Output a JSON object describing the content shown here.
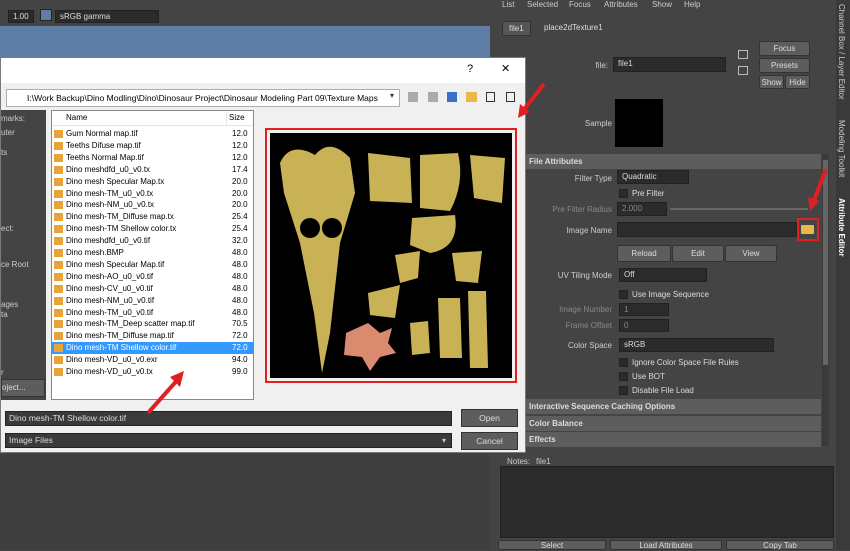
{
  "viewport": {
    "value_field": "1.00",
    "colorspace": "sRGB gamma"
  },
  "left_panel": {
    "items": [
      "marks:",
      "uter",
      "ts",
      "ect:",
      "ce Root",
      "ages",
      "ta",
      "r",
      "oject..."
    ]
  },
  "attribute_editor": {
    "menu": [
      "List",
      "Selected",
      "Focus",
      "Attributes",
      "Show",
      "Help"
    ],
    "tabs": [
      "file1",
      "place2dTexture1"
    ],
    "node_label": "file:",
    "node_value": "file1",
    "focus_label": "Focus",
    "presets_label": "Presets",
    "show_label": "Show",
    "hide_label": "Hide",
    "sample_label": "Sample",
    "file_attributes_header": "File Attributes",
    "filter_type_label": "Filter Type",
    "filter_type_value": "Quadratic",
    "pre_filter_label": "Pre Filter",
    "pre_filter_radius_label": "Pre Filter Radius",
    "pre_filter_radius_value": "2.000",
    "image_name_label": "Image Name",
    "reload_label": "Reload",
    "edit_label": "Edit",
    "view_label": "View",
    "uv_tiling_label": "UV Tiling Mode",
    "uv_tiling_value": "Off",
    "use_image_seq_label": "Use Image Sequence",
    "image_number_label": "Image Number",
    "image_number_value": "1",
    "frame_offset_label": "Frame Offset",
    "frame_offset_value": "0",
    "color_space_label": "Color Space",
    "color_space_value": "sRGB",
    "ignore_cs_label": "Ignore Color Space File Rules",
    "use_bot_label": "Use BOT",
    "disable_cache_label": "Disable File Load",
    "section_interactive": "Interactive Sequence Caching Options",
    "section_color_balance": "Color Balance",
    "section_effects": "Effects",
    "notes_label": "Notes:",
    "notes_value": "file1",
    "bottom_buttons": [
      "Select",
      "Load Attributes",
      "Copy Tab"
    ],
    "side_tabs": [
      "Channel Box / Layer Editor",
      "Modeling Toolkit",
      "Attribute Editor"
    ]
  },
  "dialog": {
    "close_glyph": "✕",
    "help_glyph": "?",
    "path": "I:\\Work Backup\\Dino Modling\\Dino\\Dinosaur Project\\Dinosaur Modeling Part 09\\Texture Maps",
    "list_header_name": "Name",
    "list_header_size": "Size",
    "files": [
      {
        "name": "Gum Normal map.tif",
        "size": "12.0"
      },
      {
        "name": "Teeths Difuse map.tif",
        "size": "12.0"
      },
      {
        "name": "Teeths Normal Map.tif",
        "size": "12.0"
      },
      {
        "name": "Dino meshdfd_u0_v0.tx",
        "size": "17.4"
      },
      {
        "name": "Dino mesh Specular Map.tx",
        "size": "20.0"
      },
      {
        "name": "Dino mesh-TM_u0_v0.tx",
        "size": "20.0"
      },
      {
        "name": "Dino mesh-NM_u0_v0.tx",
        "size": "20.0"
      },
      {
        "name": "Dino mesh-TM_Diffuse map.tx",
        "size": "25.4"
      },
      {
        "name": "Dino mesh-TM Shellow color.tx",
        "size": "25.4"
      },
      {
        "name": "Dino meshdfd_u0_v0.tif",
        "size": "32.0"
      },
      {
        "name": "Dino mesh.BMP",
        "size": "48.0"
      },
      {
        "name": "Dino mesh Specular Map.tif",
        "size": "48.0"
      },
      {
        "name": "Dino mesh-AO_u0_v0.tif",
        "size": "48.0"
      },
      {
        "name": "Dino mesh-CV_u0_v0.tif",
        "size": "48.0"
      },
      {
        "name": "Dino mesh-NM_u0_v0.tif",
        "size": "48.0"
      },
      {
        "name": "Dino mesh-TM_u0_v0.tif",
        "size": "48.0"
      },
      {
        "name": "Dino mesh-TM_Deep scatter map.tif",
        "size": "70.5"
      },
      {
        "name": "Dino mesh-TM_Diffuse map.tif",
        "size": "72.0"
      },
      {
        "name": "Dino mesh-TM Shellow color.tif",
        "size": "72.0"
      },
      {
        "name": "Dino mesh-VD_u0_v0.exr",
        "size": "94.0"
      },
      {
        "name": "Dino mesh-VD_u0_v0.tx",
        "size": "99.0"
      }
    ],
    "selected_index": 18,
    "filename_value": "Dino mesh-TM Shellow color.tif",
    "filetype_value": "Image Files",
    "open_label": "Open",
    "cancel_label": "Cancel"
  },
  "colors": {
    "highlight": "#e02020",
    "selection": "#3399ff",
    "viewport_blue": "#5d7fa6"
  }
}
